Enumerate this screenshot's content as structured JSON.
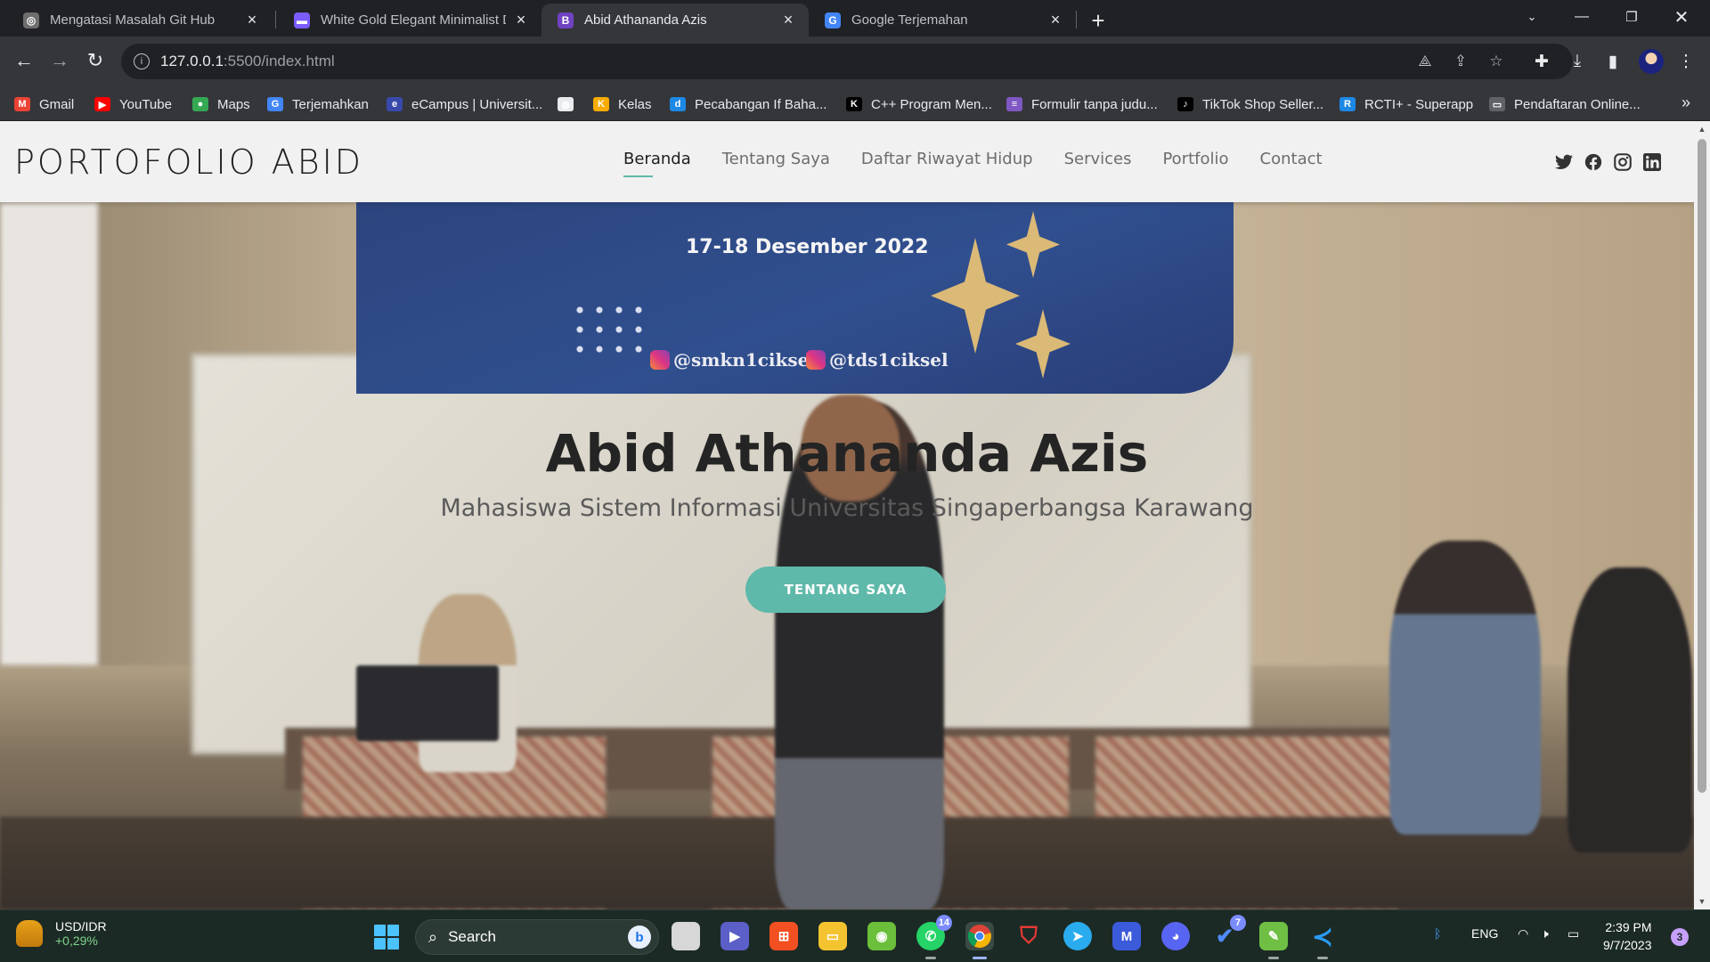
{
  "browser": {
    "tabs": [
      {
        "title": "Mengatasi Masalah Git Hub",
        "favicon": "chatgpt-icon",
        "active": false
      },
      {
        "title": "White Gold Elegant Minimalist D",
        "favicon": "canva-icon",
        "active": false
      },
      {
        "title": "Abid Athananda Azis",
        "favicon": "bootstrap-icon",
        "active": true
      },
      {
        "title": "Google Terjemahan",
        "favicon": "google-translate-icon",
        "active": false
      }
    ],
    "new_tab": "+",
    "url_host": "127.0.0.1",
    "url_rest": ":5500/index.html",
    "bookmarks": [
      {
        "label": "Gmail",
        "color": "#ea4335",
        "glyph": "M"
      },
      {
        "label": "YouTube",
        "color": "#ff0000",
        "glyph": "▶"
      },
      {
        "label": "Maps",
        "color": "#34a853",
        "glyph": "●"
      },
      {
        "label": "Terjemahkan",
        "color": "#4285f4",
        "glyph": "G"
      },
      {
        "label": "eCampus | Universit...",
        "color": "#3949ab",
        "glyph": "e"
      },
      {
        "label": "",
        "color": "#e8eaed",
        "glyph": "◍"
      },
      {
        "label": "Kelas",
        "color": "#f9ab00",
        "glyph": "K"
      },
      {
        "label": "Pecabangan If Baha...",
        "color": "#1e88e5",
        "glyph": "d"
      },
      {
        "label": "C++ Program Men...",
        "color": "#000000",
        "glyph": "K"
      },
      {
        "label": "Formulir tanpa judu...",
        "color": "#7e57c2",
        "glyph": "≡"
      },
      {
        "label": "TikTok Shop Seller...",
        "color": "#000000",
        "glyph": "♪"
      },
      {
        "label": "RCTI+ - Superapp",
        "color": "#1e88e5",
        "glyph": "R"
      },
      {
        "label": "Pendaftaran Online...",
        "color": "#5f6368",
        "glyph": "▭"
      }
    ],
    "bookmarks_more": "»"
  },
  "site": {
    "logo": "PORTOFOLIO ABID",
    "nav": [
      "Beranda",
      "Tentang Saya",
      "Daftar Riwayat Hidup",
      "Services",
      "Portfolio",
      "Contact"
    ],
    "active_nav": "Beranda",
    "social_icons": [
      "twitter-icon",
      "facebook-icon",
      "instagram-icon",
      "linkedin-icon"
    ],
    "hero": {
      "title": "Abid Athananda Azis",
      "subtitle": "Mahasiswa Sistem Informasi Universitas Singaperbangsa Karawang",
      "button": "TENTANG SAYA",
      "banner_date": "17-18 Desember 2022",
      "banner_ig_1": "@smkn1ciksel",
      "banner_ig_2": "@tds1ciksel"
    },
    "accent_color": "#5fb9aa"
  },
  "taskbar": {
    "widget_title": "USD/IDR",
    "widget_value": "+0,29%",
    "search_label": "Search",
    "whatsapp_badge": "14",
    "todo_badge": "7",
    "language": "ENG",
    "time": "2:39 PM",
    "date": "9/7/2023",
    "notifications": "3"
  }
}
